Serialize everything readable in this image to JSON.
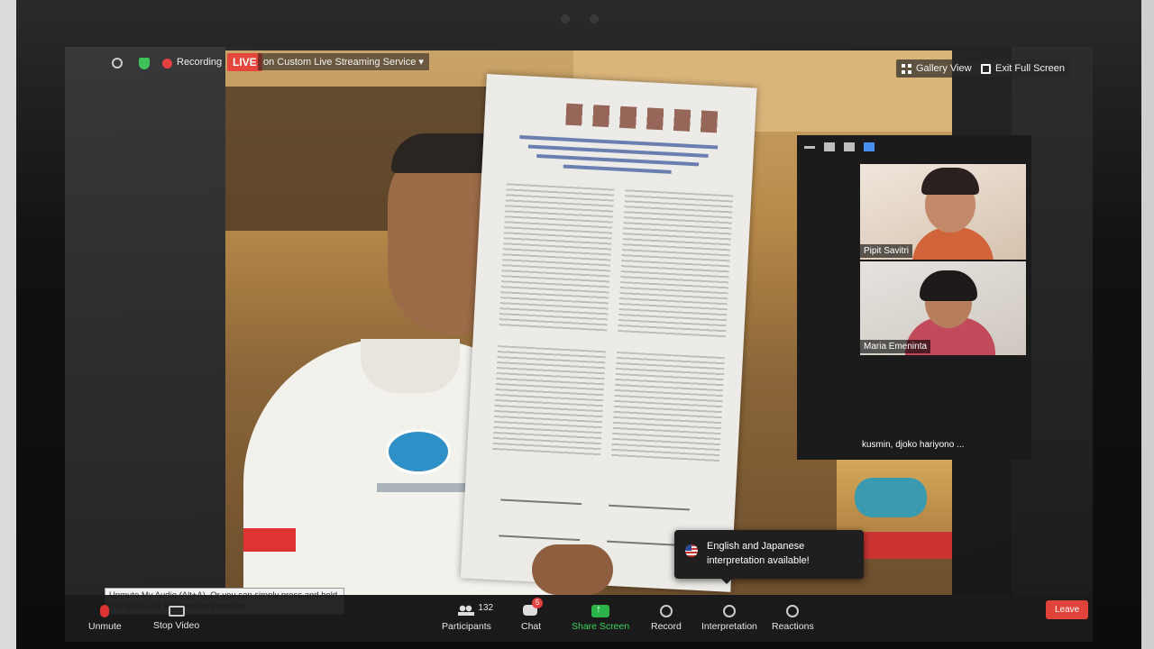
{
  "topbar": {
    "recording_label": "Recording",
    "live_badge": "LIVE",
    "streaming_label": "on Custom Live Streaming Service",
    "dropdown_glyph": "▾",
    "gallery_view_label": "Gallery View",
    "exit_fullscreen_label": "Exit Full Screen"
  },
  "participants_panel": {
    "tiles": [
      {
        "name": "Pipit Savitri"
      },
      {
        "name": "Maria Emeninta"
      }
    ],
    "overflow_label": "kusmin, djoko hariyono ..."
  },
  "interpretation_popup": {
    "line1": "English and Japanese",
    "line2": "interpretation available!",
    "flag_icon": "us-flag-icon"
  },
  "unmute_tooltip": {
    "text": "Unmute My Audio (Alt+A). Or you can simply press and hold the space bar to temporarily unmute."
  },
  "toolbar": {
    "unmute_label": "Unmute",
    "stop_video_label": "Stop Video",
    "participants_label": "Participants",
    "participants_count": "132",
    "chat_label": "Chat",
    "chat_badge": "5",
    "share_screen_label": "Share Screen",
    "record_label": "Record",
    "interpretation_label": "Interpretation",
    "reactions_label": "Reactions",
    "leave_label": "Leave"
  },
  "colors": {
    "live_red": "#e5463b",
    "share_green": "#2bb34a",
    "leave_red": "#e0433a",
    "active_view_blue": "#4a8ef0"
  }
}
